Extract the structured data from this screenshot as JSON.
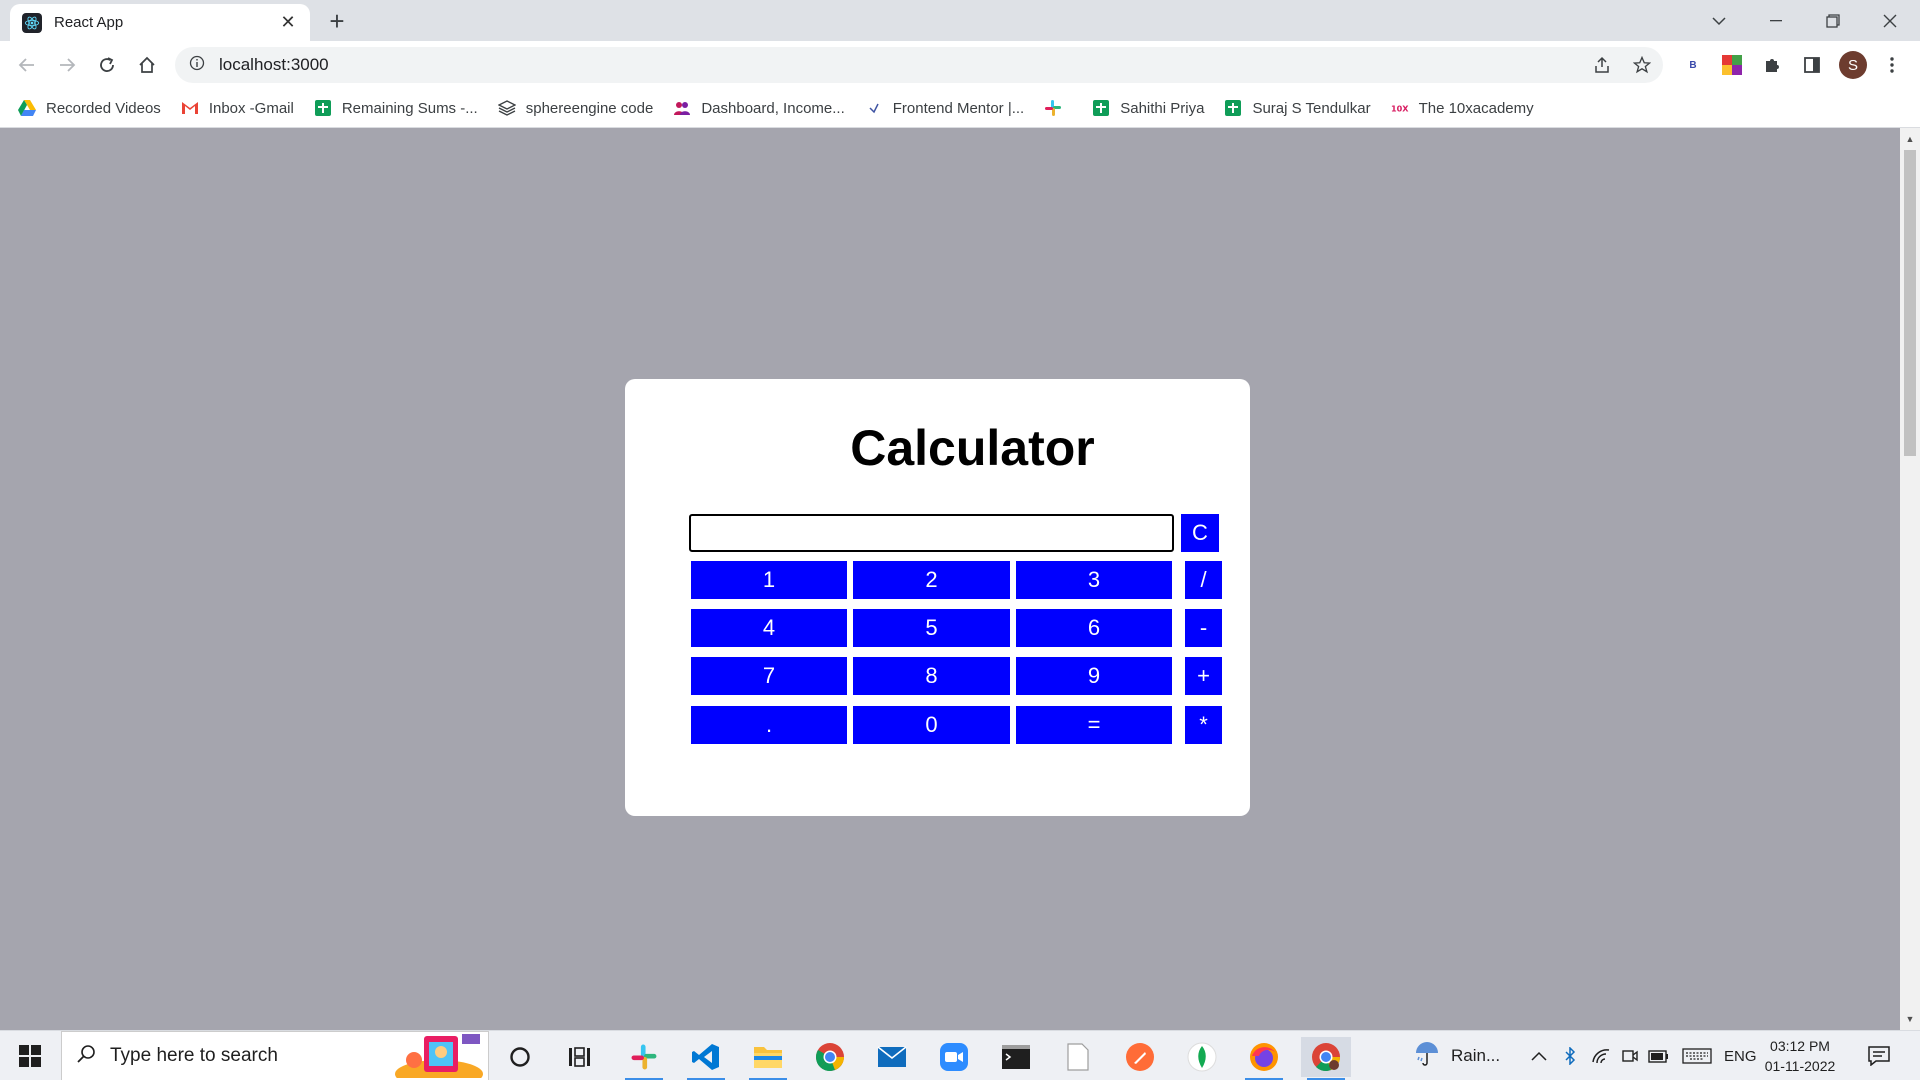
{
  "browser": {
    "tab_title": "React App",
    "url": "localhost:3000",
    "profile_initial": "S",
    "bookmarks": [
      {
        "label": "Recorded Videos",
        "icon": "google-drive-icon"
      },
      {
        "label": "Inbox -Gmail",
        "icon": "gmail-icon"
      },
      {
        "label": "Remaining Sums -...",
        "icon": "google-sheets-icon"
      },
      {
        "label": "sphereengine code",
        "icon": "layers-icon"
      },
      {
        "label": "Dashboard, Income...",
        "icon": "users-icon"
      },
      {
        "label": "Frontend Mentor |...",
        "icon": "frontend-mentor-icon"
      },
      {
        "label": "",
        "icon": "slack-icon"
      },
      {
        "label": "Sahithi Priya",
        "icon": "google-sheets-icon"
      },
      {
        "label": "Suraj S Tendulkar",
        "icon": "google-sheets-icon"
      },
      {
        "label": "The 10xacademy",
        "icon": "10x-icon"
      }
    ]
  },
  "calculator": {
    "title": "Calculator",
    "display_value": "",
    "clear_label": "C",
    "keys": {
      "k1": "1",
      "k2": "2",
      "k3": "3",
      "div": "/",
      "k4": "4",
      "k5": "5",
      "k6": "6",
      "sub": "-",
      "k7": "7",
      "k8": "8",
      "k9": "9",
      "add": "+",
      "dot": ".",
      "k0": "0",
      "eq": "=",
      "mul": "*"
    }
  },
  "taskbar": {
    "search_placeholder": "Type here to search",
    "weather": "Rain...",
    "language": "ENG",
    "time": "03:12 PM",
    "date": "01-11-2022"
  },
  "colors": {
    "page_background": "#a5a5ae",
    "key_blue": "#0000ff",
    "card": "#ffffff"
  }
}
